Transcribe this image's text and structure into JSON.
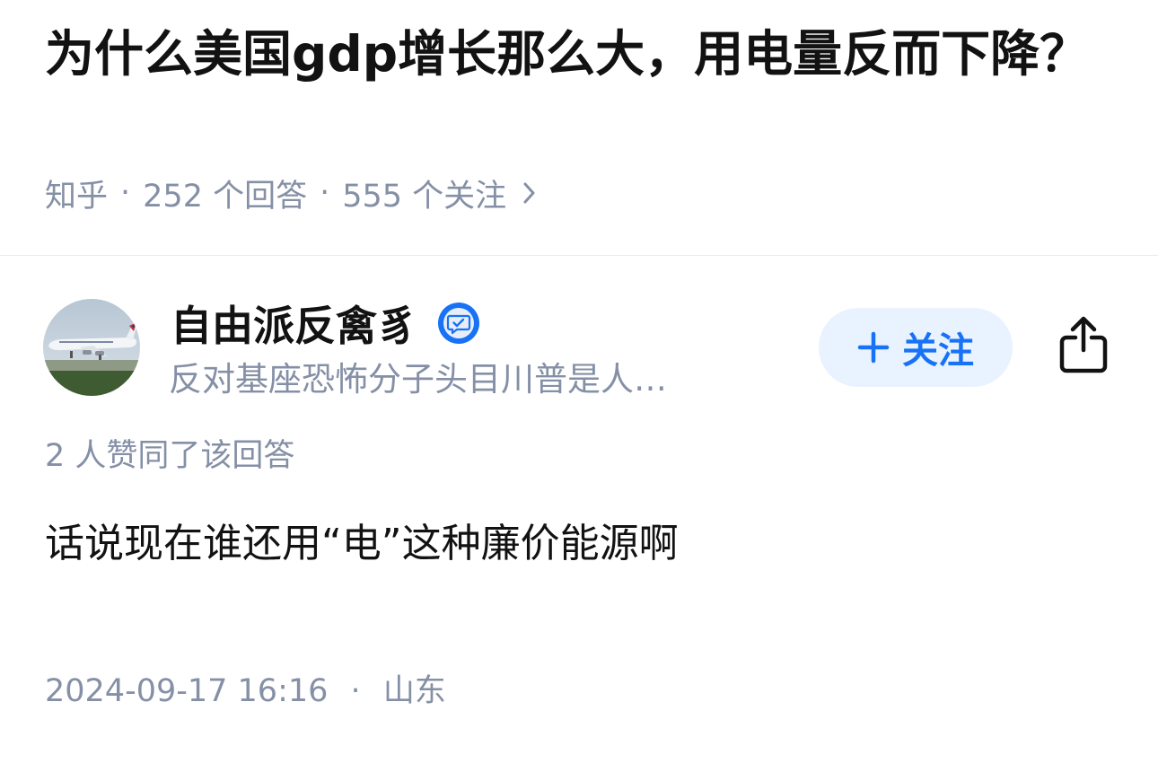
{
  "question": {
    "title": "为什么美国gdp增长那么大，用电量反而下降？",
    "source": "知乎",
    "separator": "·",
    "answers": "252 个回答",
    "followers": "555 个关注"
  },
  "author": {
    "name": "自由派反禽豸",
    "bio": "反对基座恐怖分子头目川普是人…",
    "follow_label": "关注"
  },
  "answer": {
    "voteup_text": "2 人赞同了该回答",
    "content": "话说现在谁还用“电”这种廉价能源啊",
    "timestamp": "2024-09-17 16:16",
    "separator": "·",
    "location": "山东"
  },
  "icons": {
    "chevron": "chevron-right-icon",
    "badge": "verified-badge-icon",
    "plus": "plus-icon",
    "share": "share-icon"
  },
  "colors": {
    "accent": "#1772f6",
    "follow_bg": "#e9f2ff",
    "meta_text": "#8590a6",
    "main_text": "#121212"
  }
}
